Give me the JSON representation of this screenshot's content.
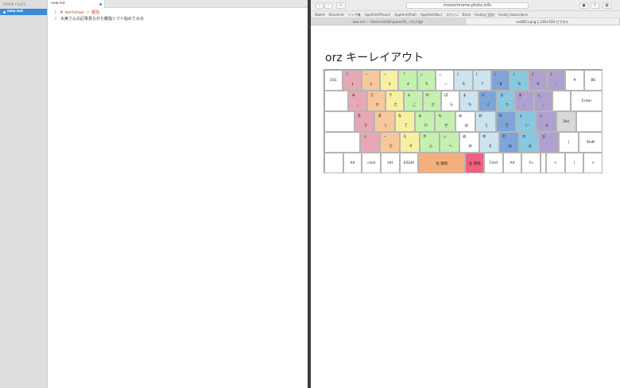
{
  "sidebar": {
    "header": "OPEN FILES",
    "file": "new.md"
  },
  "editor": {
    "tab": "new.md",
    "lines": [
      {
        "n": "1",
        "parts": [
          {
            "c": "md",
            "t": "# markdown > "
          },
          {
            "c": "md",
            "t": "親指"
          }
        ]
      },
      {
        "n": "2",
        "parts": [
          {
            "c": "txt",
            "t": "大実さんの記事見ながら親指シフト始めてみる"
          }
        ]
      }
    ]
  },
  "browser": {
    "url": "monochrome-photo.info",
    "bookmarks": [
      "Wallet",
      "Sharehint",
      "リンク集",
      "AppHint(iPhone)",
      "AppHint(iPad)",
      "AppHint(Mac)",
      "スケジュ",
      "Brisk",
      "Feedlyに追加",
      "Feedly Subscribers"
    ],
    "tabs": [
      {
        "label": "new.md — /Users/eiiti/Dropbox/00_ブログ/git",
        "active": false
      },
      {
        "label": "orz0011.png 1,216×534 ピクセル",
        "active": true
      }
    ],
    "page_title": "orz キーレイアウト"
  },
  "colors": {
    "sidebar_sel": "#3b8bd8",
    "markdown": "#d4502f"
  },
  "keyboard": {
    "rows": [
      {
        "keys": [
          {
            "w": 1.0,
            "c": "#ffffff",
            "lbl": "ESC"
          },
          {
            "w": 1.0,
            "c": "#e6a8b4",
            "tl": "?",
            "bl": "1"
          },
          {
            "w": 1.0,
            "c": "#f8c89c",
            "tl": "・",
            "bl": "2"
          },
          {
            "w": 1.0,
            "c": "#f8f0a0",
            "tl": "~",
            "bl": "3"
          },
          {
            "w": 1.0,
            "c": "#c4f0b0",
            "tl": "「",
            "bl": "4"
          },
          {
            "w": 1.0,
            "c": "#c4f0b0",
            "tl": "」",
            "bl": "5"
          },
          {
            "w": 1.0,
            "c": "#ffffff",
            "tl": "=",
            "bl": "ー"
          },
          {
            "w": 1.0,
            "c": "#cce4f0",
            "tl": "[",
            "bl": "6"
          },
          {
            "w": 1.0,
            "c": "#cce4f0",
            "tl": "]",
            "bl": "7"
          },
          {
            "w": 1.0,
            "c": "#7ea4d8",
            "tl": "(",
            "bl": "8"
          },
          {
            "w": 1.0,
            "c": "#88c8e0",
            "tl": ")",
            "bl": "9"
          },
          {
            "w": 1.0,
            "c": "#b0a0d0",
            "tl": "{",
            "bl": "0"
          },
          {
            "w": 1.0,
            "c": "#b0a0d0",
            "tl": "}",
            "bl": "-"
          },
          {
            "w": 1.0,
            "c": "#ffffff",
            "lbl": "¥"
          },
          {
            "w": 1.0,
            "c": "#ffffff",
            "lbl": "BS"
          }
        ]
      },
      {
        "keys": [
          {
            "w": 1.3,
            "c": "#ffffff",
            "lbl": ""
          },
          {
            "w": 1.0,
            "c": "#e6a8b4",
            "tl": "ぁ",
            "bl": "。"
          },
          {
            "w": 1.0,
            "c": "#f8c89c",
            "tl": "え",
            "bl": "か"
          },
          {
            "w": 1.0,
            "c": "#f8f0a0",
            "tl": "り",
            "bl": "た"
          },
          {
            "w": 1.0,
            "c": "#c4f0b0",
            "tl": "ゃ",
            "bl": "こ"
          },
          {
            "w": 1.0,
            "c": "#c4f0b0",
            "tl": "れ",
            "bl": "さ"
          },
          {
            "w": 1.0,
            "c": "#ffffff",
            "tl": "ぱ",
            "bl": "ら"
          },
          {
            "w": 1.0,
            "c": "#cce4f0",
            "tl": "よ",
            "bl": "ち"
          },
          {
            "w": 1.0,
            "c": "#7ea4d8",
            "tl": "に",
            "bl": "く"
          },
          {
            "w": 1.0,
            "c": "#88c8e0",
            "tl": "る",
            "bl": "つ"
          },
          {
            "w": 1.0,
            "c": "#b0a0d0",
            "tl": "ま",
            "bl": "、"
          },
          {
            "w": 1.0,
            "c": "#b0a0d0",
            "tl": "ぇ",
            "bl": "、"
          },
          {
            "w": 1.0,
            "c": "#ffffff",
            "lbl": ""
          },
          {
            "w": 1.7,
            "c": "#ffffff",
            "lbl": "Enter"
          }
        ]
      },
      {
        "keys": [
          {
            "w": 1.5,
            "c": "#ffffff",
            "lbl": ""
          },
          {
            "w": 1.0,
            "c": "#e6a8b4",
            "tl": "を",
            "bl": "う"
          },
          {
            "w": 1.0,
            "c": "#f8c89c",
            "tl": "あ",
            "bl": "し"
          },
          {
            "w": 1.0,
            "c": "#f8f0a0",
            "tl": "な",
            "bl": "て"
          },
          {
            "w": 1.0,
            "c": "#c4f0b0",
            "tl": "ゅ",
            "bl": "け"
          },
          {
            "w": 1.0,
            "c": "#c4f0b0",
            "tl": "も",
            "bl": "せ"
          },
          {
            "w": 1.0,
            "c": "#ffffff",
            "tl": "み",
            "bl": "は"
          },
          {
            "w": 1.0,
            "c": "#cce4f0",
            "tl": "お",
            "bl": "と"
          },
          {
            "w": 1.0,
            "c": "#7ea4d8",
            "tl": "の",
            "bl": "き"
          },
          {
            "w": 1.0,
            "c": "#88c8e0",
            "tl": "ょ",
            "bl": "い"
          },
          {
            "w": 1.0,
            "c": "#b0a0d0",
            "tl": "っ",
            "bl": "ん"
          },
          {
            "w": 1.0,
            "c": "#d8d8d8",
            "lbl": "Del"
          },
          {
            "w": 1.3,
            "c": "#ffffff",
            "lbl": ""
          }
        ]
      },
      {
        "keys": [
          {
            "w": 1.8,
            "c": "#ffffff",
            "lbl": ""
          },
          {
            "w": 1.0,
            "c": "#e6a8b4",
            "tl": "ぅ",
            "bl": ""
          },
          {
            "w": 1.0,
            "c": "#f8c89c",
            "tl": "ー",
            "bl": "ひ"
          },
          {
            "w": 1.0,
            "c": "#f8f0a0",
            "tl": "ろ",
            "bl": "す"
          },
          {
            "w": 1.0,
            "c": "#c4f0b0",
            "tl": "や",
            "bl": "ふ"
          },
          {
            "w": 1.0,
            "c": "#c4f0b0",
            "tl": "ぃ",
            "bl": "へ"
          },
          {
            "w": 1.0,
            "c": "#ffffff",
            "tl": "ぬ",
            "bl": "め"
          },
          {
            "w": 1.0,
            "c": "#cce4f0",
            "tl": "ゆ",
            "bl": "そ"
          },
          {
            "w": 1.0,
            "c": "#7ea4d8",
            "tl": "む",
            "bl": "ね"
          },
          {
            "w": 1.0,
            "c": "#88c8e0",
            "tl": "わ",
            "bl": "ほ"
          },
          {
            "w": 1.0,
            "c": "#b0a0d0",
            "tl": "ぉ",
            "bl": ""
          },
          {
            "w": 1.0,
            "c": "#ffffff",
            "lbl": "|"
          },
          {
            "w": 1.2,
            "c": "#ffffff",
            "lbl": "Shift"
          }
        ]
      },
      {
        "keys": [
          {
            "w": 1.0,
            "c": "#ffffff",
            "lbl": ""
          },
          {
            "w": 1.0,
            "c": "#ffffff",
            "lbl": "Alt"
          },
          {
            "w": 1.0,
            "c": "#ffffff",
            "lbl": "cmd"
          },
          {
            "w": 1.0,
            "c": "#ffffff",
            "lbl": "HH"
          },
          {
            "w": 1.0,
            "c": "#ffffff",
            "lbl": "EISUU"
          },
          {
            "w": 2.5,
            "c": "#f4b07c",
            "lbl": "左 親指"
          },
          {
            "w": 1.0,
            "c": "#f06080",
            "lbl": "右 親指"
          },
          {
            "w": 1.0,
            "c": "#ffffff",
            "lbl": "Cmd"
          },
          {
            "w": 1.0,
            "c": "#ffffff",
            "lbl": "Alt"
          },
          {
            "w": 1.0,
            "c": "#ffffff",
            "lbl": "Fn"
          },
          {
            "w": 0.3,
            "c": "#ffffff",
            "lbl": ""
          },
          {
            "w": 1.0,
            "c": "#ffffff",
            "lbl": "<"
          },
          {
            "w": 1.0,
            "c": "#ffffff",
            "lbl": "|"
          },
          {
            "w": 1.0,
            "c": "#ffffff",
            "lbl": ">"
          }
        ]
      }
    ]
  }
}
